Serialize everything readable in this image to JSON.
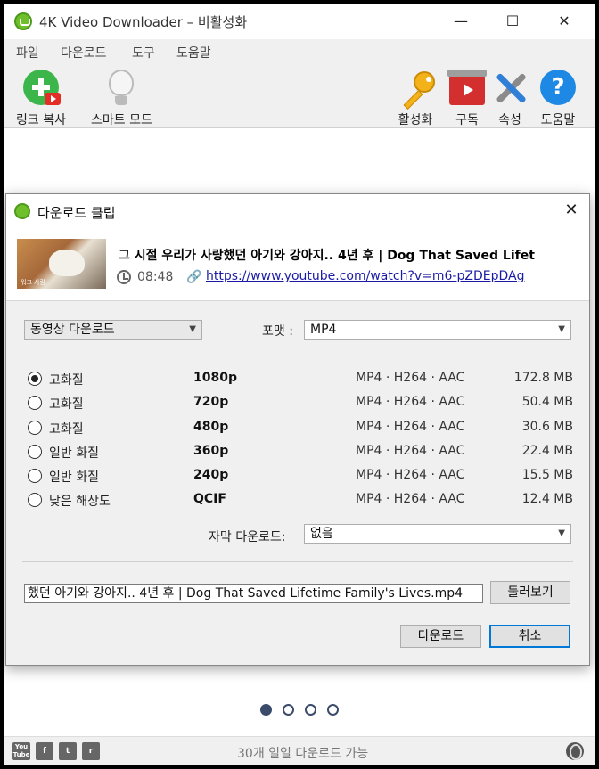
{
  "window": {
    "title": "4K Video Downloader – 비활성화",
    "minimize": "—",
    "maximize": "☐",
    "close": "✕"
  },
  "menu": {
    "items": [
      "파일",
      "다운로드",
      "도구",
      "도움말"
    ]
  },
  "toolbar": {
    "paste_link": "링크 복사",
    "smart_mode": "스마트 모드",
    "activate": "활성화",
    "subscribe": "구독",
    "preferences": "속성",
    "help": "도움말",
    "help_glyph": "?"
  },
  "dialog": {
    "title": "다운로드 클립",
    "close": "✕",
    "video": {
      "title": "그 시절 우리가 사랑했던 아기와 강아지.. 4년 후 | Dog That Saved Lifet",
      "duration": "08:48",
      "url": "https://www.youtube.com/watch?v=m6-pZDEpDAg",
      "thumb_caption": "워크 사람"
    },
    "type_select": "동영상 다운로드",
    "format_label": "포맷 :",
    "format_value": "MP4",
    "qualities": [
      {
        "name": "고화질",
        "res": "1080p",
        "codec": "MP4 · H264 · AAC",
        "size": "172.8 MB",
        "selected": true
      },
      {
        "name": "고화질",
        "res": "720p",
        "codec": "MP4 · H264 · AAC",
        "size": "50.4 MB",
        "selected": false
      },
      {
        "name": "고화질",
        "res": "480p",
        "codec": "MP4 · H264 · AAC",
        "size": "30.6 MB",
        "selected": false
      },
      {
        "name": "일반 화질",
        "res": "360p",
        "codec": "MP4 · H264 · AAC",
        "size": "22.4 MB",
        "selected": false
      },
      {
        "name": "일반 화질",
        "res": "240p",
        "codec": "MP4 · H264 · AAC",
        "size": "15.5 MB",
        "selected": false
      },
      {
        "name": "낮은 해상도",
        "res": "QCIF",
        "codec": "MP4 · H264 · AAC",
        "size": "12.4 MB",
        "selected": false
      }
    ],
    "subtitles_label": "자막 다운로드:",
    "subtitles_value": "없음",
    "save_path": "했던 아기와 강아지.. 4년 후 | Dog That Saved Lifetime Family's Lives.mp4",
    "browse": "둘러보기",
    "download": "다운로드",
    "cancel": "취소"
  },
  "status": {
    "text": "30개 일일 다운로드 가능",
    "social": [
      "You Tube",
      "f",
      "t",
      "r"
    ]
  },
  "pager": {
    "count": 4,
    "active": 0
  }
}
